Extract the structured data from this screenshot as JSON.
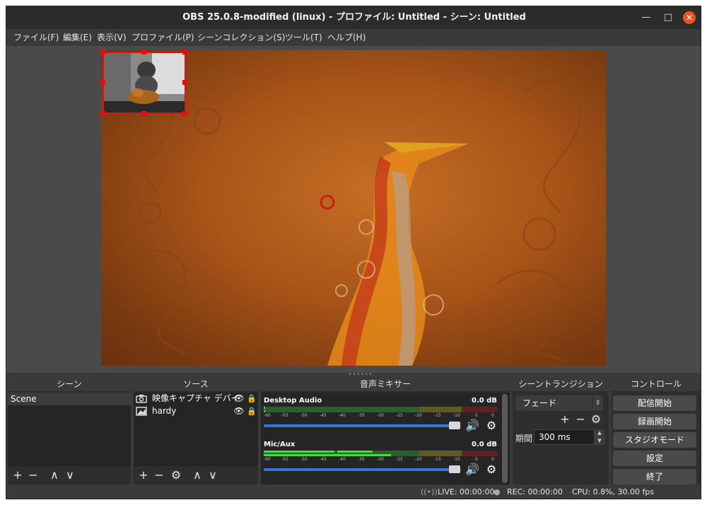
{
  "window": {
    "title": "OBS 25.0.8-modified (linux) - プロファイル: Untitled - シーン: Untitled",
    "minimize_glyph": "—",
    "maximize_glyph": "□",
    "close_glyph": "✕"
  },
  "menu": [
    {
      "label": "ファイル(F)"
    },
    {
      "label": "編集(E)"
    },
    {
      "label": "表示(V)"
    },
    {
      "label": "プロファイル(P)"
    },
    {
      "label": "シーンコレクション(S)"
    },
    {
      "label": "ツール(T)"
    },
    {
      "label": "ヘルプ(H)"
    }
  ],
  "docks": {
    "scenes": {
      "title": "シーン",
      "items": [
        {
          "label": "Scene"
        }
      ]
    },
    "sources": {
      "title": "ソース",
      "items": [
        {
          "label": "映像キャプチャ デバイ",
          "icon": "camera-icon"
        },
        {
          "label": "hardy",
          "icon": "image-icon"
        }
      ]
    },
    "mixer": {
      "title": "音声ミキサー",
      "scale": [
        "-60",
        "-55",
        "-50",
        "-45",
        "-40",
        "-35",
        "-30",
        "-25",
        "-20",
        "-15",
        "-10",
        "-5",
        "0"
      ],
      "channels": [
        {
          "name": "Desktop Audio",
          "db": "0.0 dB",
          "volume_fraction": 0.95
        },
        {
          "name": "Mic/Aux",
          "db": "0.0 dB",
          "volume_fraction": 0.95
        }
      ]
    },
    "transitions": {
      "title": "シーントランジション",
      "selected": "フェード",
      "duration_label": "期間",
      "duration_value": "300 ms"
    },
    "controls": {
      "title": "コントロール",
      "buttons": [
        "配信開始",
        "録画開始",
        "スタジオモード",
        "設定",
        "終了"
      ]
    }
  },
  "toolbar_glyphs": {
    "add": "+",
    "remove": "−",
    "up": "∧",
    "down": "∨",
    "settings": "⚙"
  },
  "status": {
    "live": "LIVE: 00:00:00",
    "rec": "REC: 00:00:00",
    "cpu": "CPU: 0.8%, 30.00 fps"
  },
  "colors": {
    "accent_close": "#e95420",
    "selection": "#e01010",
    "fader": "#2f7bd8",
    "meter_green": "#3a9a3a",
    "meter_yellow": "#a09a2a",
    "meter_red": "#9a2a2a"
  }
}
